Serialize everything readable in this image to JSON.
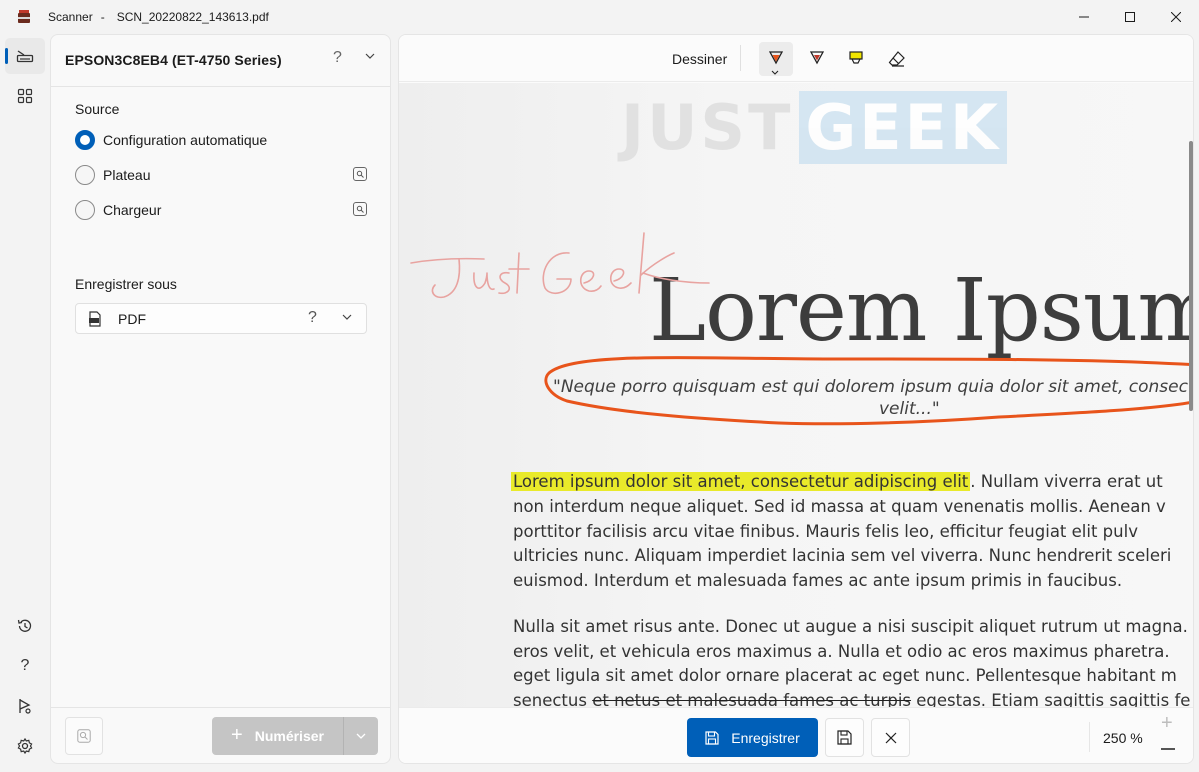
{
  "window": {
    "app_name": "Scanner",
    "separator": "-",
    "file_name": "SCN_20220822_143613.pdf"
  },
  "rail": {
    "items": [
      "scanner-icon",
      "apps-grid-icon",
      "history-icon",
      "help-icon",
      "feedback-icon",
      "settings-icon"
    ]
  },
  "panel": {
    "scanner_name": "EPSON3C8EB4 (ET-4750 Series)",
    "help": "?",
    "source_label": "Source",
    "sources": [
      {
        "label": "Configuration automatique",
        "checked": true
      },
      {
        "label": "Plateau",
        "checked": false
      },
      {
        "label": "Chargeur",
        "checked": false
      }
    ],
    "save_as_label": "Enregistrer sous",
    "format": "PDF",
    "format_help": "?",
    "scan_button": "Numériser",
    "scan_plus": "+"
  },
  "view": {
    "draw_label": "Dessiner",
    "tools": [
      "ballpoint-pen-icon",
      "pencil-icon",
      "highlighter-icon",
      "eraser-icon"
    ],
    "watermark_left": "JUST",
    "watermark_right": "GEEK",
    "document": {
      "headline": "Lorem Ipsum",
      "quote_line1": "\"Neque porro quisquam est qui dolorem ipsum quia dolor sit amet, consectetur, adipisci",
      "quote_line2": "velit...\"",
      "handwriting": "JustGeek",
      "p1_highlight": "Lorem ipsum dolor sit amet, consectetur adipiscing elit",
      "p1_rest": ". Nullam viverra erat ut",
      "p1_lines": [
        "non interdum neque aliquet. Sed id massa at quam venenatis mollis. Aenean v",
        "porttitor facilisis arcu vitae finibus. Mauris felis leo, efficitur feugiat elit pulv",
        "ultricies nunc. Aliquam imperdiet lacinia sem vel viverra. Nunc hendrerit sceleri",
        "euismod. Interdum et malesuada fames ac ante ipsum primis in faucibus."
      ],
      "p2_lines": [
        "Nulla sit amet risus ante. Donec ut augue a nisi suscipit aliquet rutrum ut magna.",
        "eros velit, et vehicula eros maximus a. Nulla et odio ac eros maximus pharetra.",
        "eget ligula sit amet dolor ornare placerat ac eget nunc. Pellentesque habitant m"
      ],
      "p2_last_pre": "senectus ",
      "p2_last_strike": "et netus et malesuada fames ac turpis",
      "p2_last_post": " egestas. Etiam sagittis sagittis fe"
    },
    "save_button": "Enregistrer",
    "zoom": "250 %",
    "zoom_plus": "+"
  },
  "colors": {
    "accent": "#005fb8",
    "highlight": "#e9ea2a",
    "pen_orange": "#e8541b",
    "pencil_pink": "#e8a3a0"
  }
}
